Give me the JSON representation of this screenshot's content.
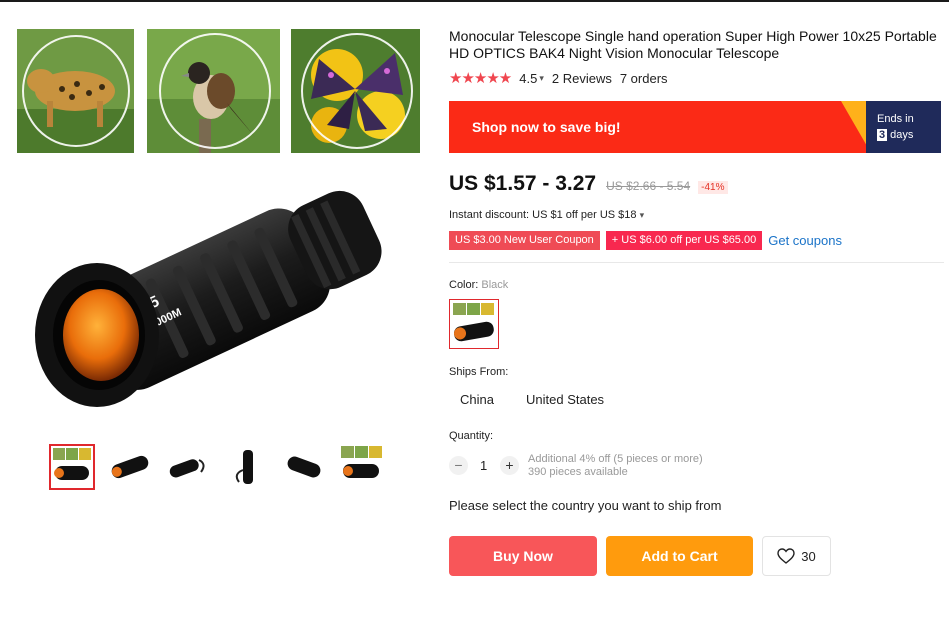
{
  "product": {
    "title": "Monocular Telescope Single hand operation Super High Power 10x25 Portable HD OPTICS BAK4 Night Vision Monocular Telescope",
    "stars": "★★★★★",
    "rating": "4.5",
    "reviews": "2 Reviews",
    "orders": "7 orders",
    "gallery": {
      "main_image": "black 10x25 monocular telescope",
      "lens_text_1": "10x25",
      "lens_text_2": "101M/1000M",
      "thumbnail_count": 6
    }
  },
  "banner": {
    "text": "Shop now to save big!",
    "ends_label": "Ends in",
    "ends_number": "3",
    "ends_unit": "days",
    "colors": {
      "background": "#fb2a16",
      "accent": "#ffb11a",
      "timer_bg": "#1f2a5a"
    }
  },
  "price": {
    "current": "US $1.57 - 3.27",
    "original": "US $2.66 - 5.54",
    "discount": "-41%"
  },
  "promotions": {
    "instant_discount": "Instant discount: US $1 off per US $18",
    "coupon_1": "US $3.00 New User Coupon",
    "coupon_2": "+ US $6.00 off per US $65.00",
    "get_coupons": "Get coupons"
  },
  "options": {
    "color_label": "Color: ",
    "color_value": "Black",
    "ships_from_label": "Ships From:",
    "ships_from": [
      "China",
      "United States"
    ]
  },
  "quantity": {
    "label": "Quantity:",
    "value": "1",
    "minus": "−",
    "plus": "+",
    "info_line_1": "Additional 4% off (5 pieces or more)",
    "info_line_2": "390 pieces available"
  },
  "messages": {
    "select_country": "Please select the country you want to ship from"
  },
  "actions": {
    "buy_now": "Buy Now",
    "add_to_cart": "Add to Cart",
    "wishlist_count": "30",
    "colors": {
      "buy": "#f85659",
      "cart": "#ff9b0d"
    }
  }
}
